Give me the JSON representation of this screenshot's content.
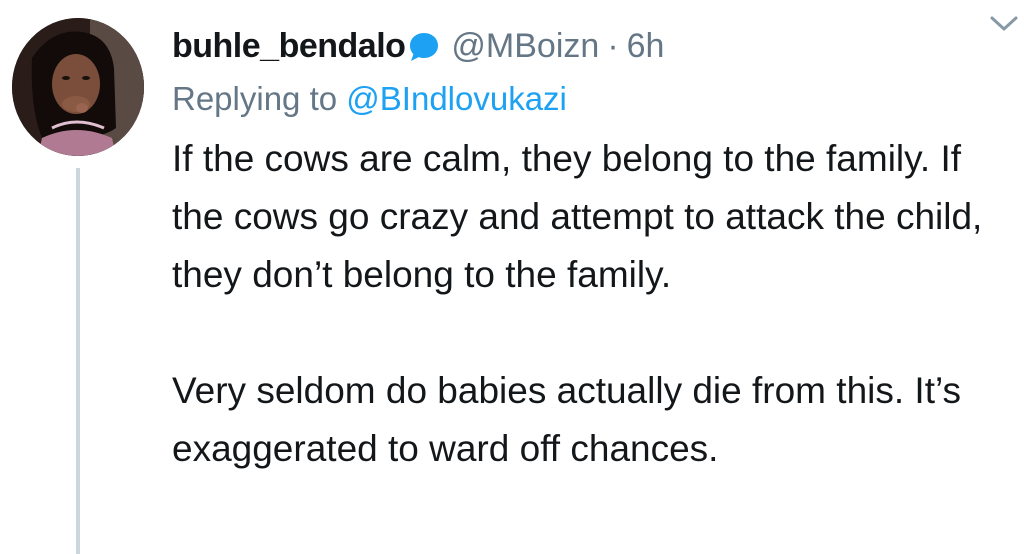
{
  "tweet": {
    "display_name": "buhle_bendalo",
    "handle": "@MBoizn",
    "separator": "·",
    "time": "6h",
    "replying_prefix": "Replying to",
    "replying_to": "@BIndlovukazi",
    "paragraphs": [
      "If the cows are calm, they belong to the family. If the cows go crazy and attempt to attack the child, they don’t belong to the family.",
      "Very seldom do babies actually die from this. It’s exaggerated to ward off chances."
    ],
    "accent_color": "#1da1f2",
    "secondary_text_color": "#657786",
    "thread_line_color": "#ccd6dd"
  }
}
